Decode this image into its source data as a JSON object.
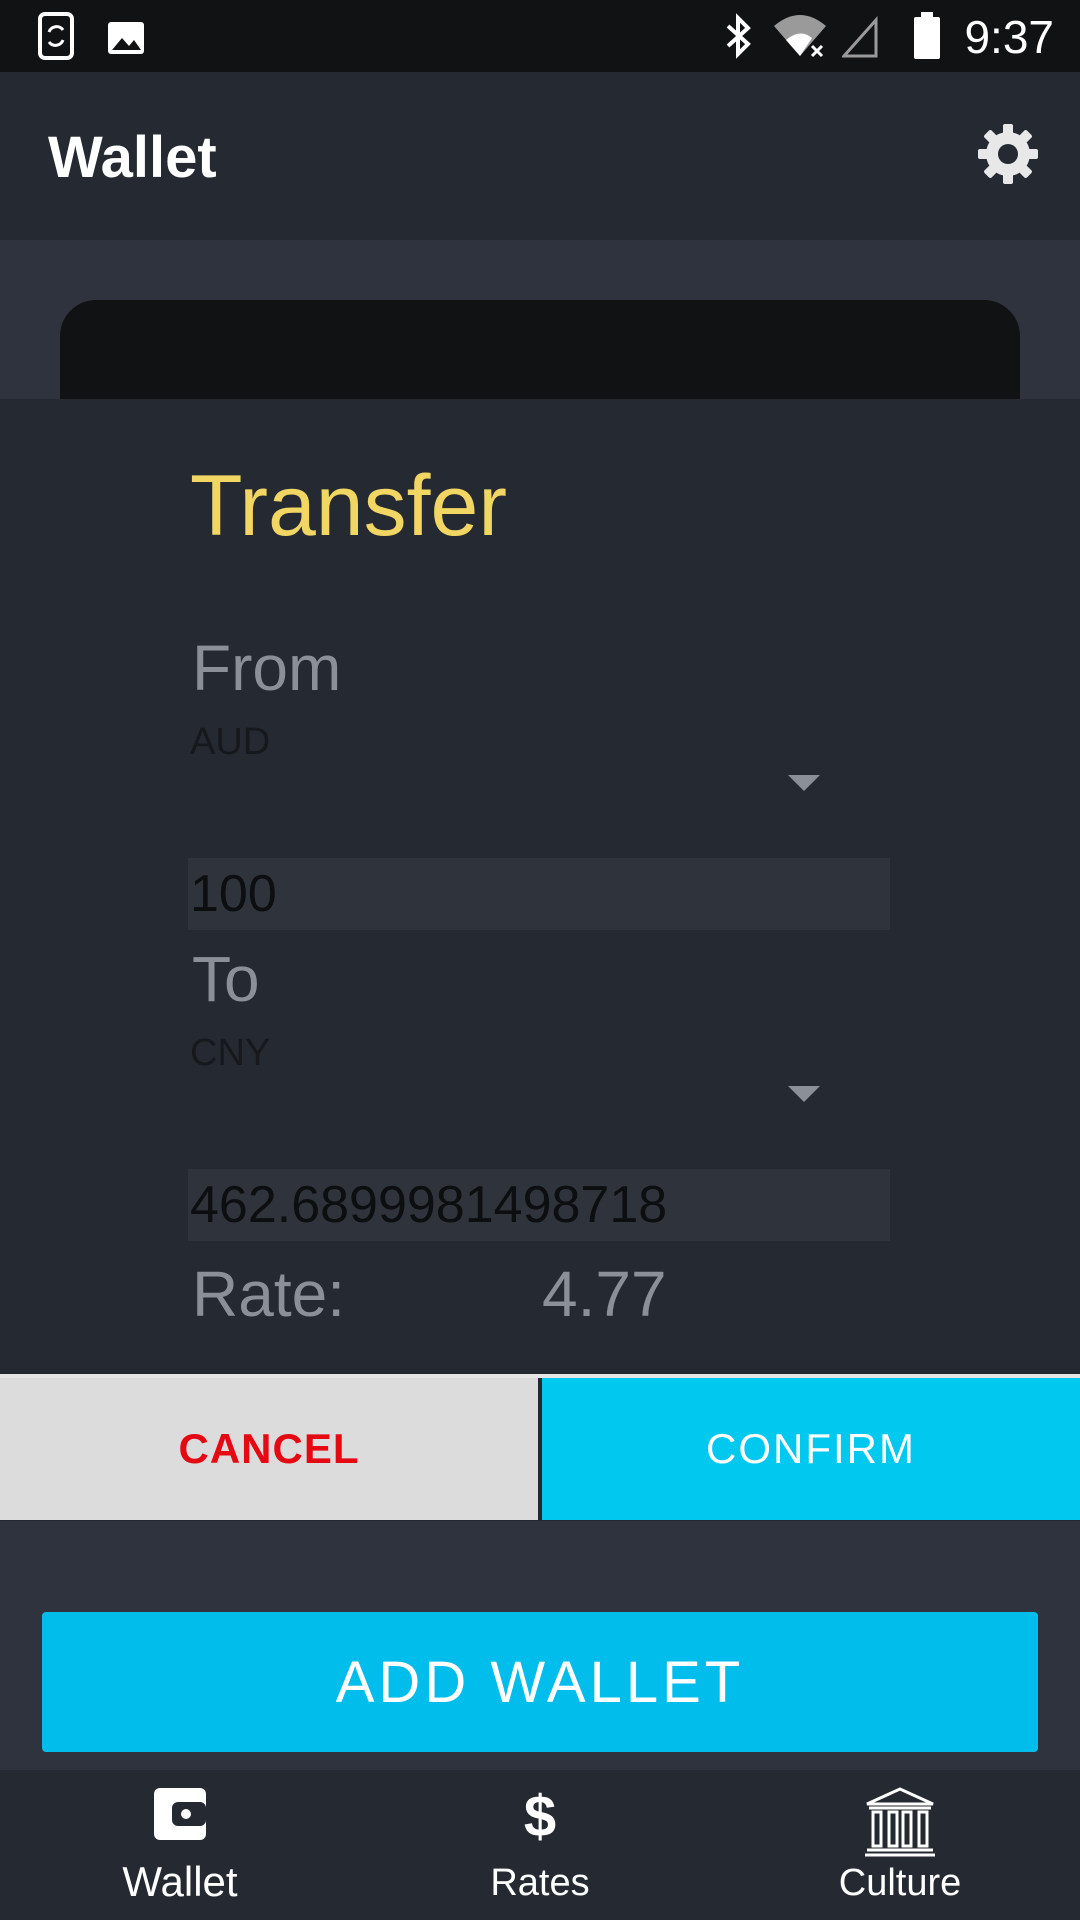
{
  "status_bar": {
    "time": "9:37",
    "icons": [
      "screen-rotate-icon",
      "image-icon",
      "bluetooth-icon",
      "wifi-off-icon",
      "signal-icon",
      "battery-icon"
    ]
  },
  "app_bar": {
    "title": "Wallet",
    "settings_icon": "gear-icon"
  },
  "dialog": {
    "title": "Transfer",
    "from_label": "From",
    "from_currency": "AUD",
    "from_amount": "100",
    "to_label": "To",
    "to_currency": "CNY",
    "to_amount": "462.6899981498718",
    "rate_label": "Rate:",
    "rate_value": "4.77",
    "cancel_label": "CANCEL",
    "confirm_label": "CONFIRM"
  },
  "main": {
    "add_wallet_label": "ADD WALLET"
  },
  "bottom_nav": {
    "items": [
      {
        "label": "Wallet",
        "icon": "wallet-icon",
        "active": true
      },
      {
        "label": "Rates",
        "icon": "dollar-icon",
        "active": false
      },
      {
        "label": "Culture",
        "icon": "museum-icon",
        "active": false
      }
    ]
  },
  "colors": {
    "accent": "#00c8ee",
    "title_yellow": "#f1d664",
    "cancel_red": "#e50914",
    "surface": "#252932"
  }
}
